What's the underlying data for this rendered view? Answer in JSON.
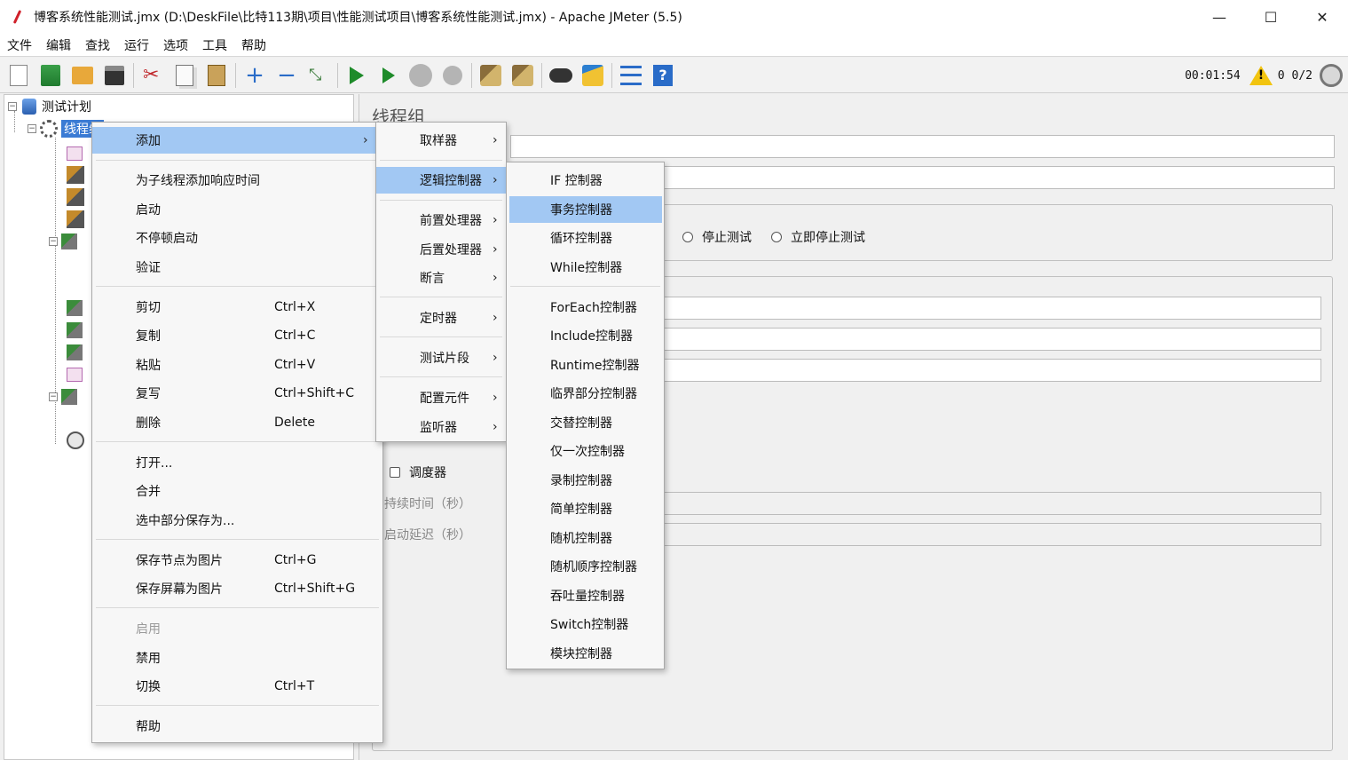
{
  "window": {
    "title": "博客系统性能测试.jmx (D:\\DeskFile\\比特113期\\项目\\性能测试项目\\博客系统性能测试.jmx) - Apache JMeter (5.5)",
    "minimize": "—",
    "maximize": "☐",
    "close": "✕"
  },
  "menubar": [
    "文件",
    "编辑",
    "查找",
    "运行",
    "选项",
    "工具",
    "帮助"
  ],
  "toolbar": {
    "icons": [
      "new-icon",
      "templates-icon",
      "open-icon",
      "save-icon",
      "cut-icon",
      "copy-icon",
      "paste-icon",
      "expand-icon",
      "collapse-icon",
      "toggle-icon",
      "start-icon",
      "start-no-pause-icon",
      "stop-icon",
      "shutdown-icon",
      "clear-icon",
      "clear-all-icon",
      "search-icon",
      "reset-search-icon",
      "function-helper-icon",
      "help-icon"
    ],
    "elapsed": "00:01:54",
    "error_count": "0",
    "threads": "0/2"
  },
  "tree": {
    "root": "测试计划",
    "selected": "线程组"
  },
  "panel": {
    "title": "线程组",
    "on_error_options": [
      "停止测试",
      "立即停止测试"
    ],
    "scheduler_label": "调度器",
    "duration_label": "持续时间（秒）",
    "startup_delay_label": "启动延迟（秒）"
  },
  "context_menu": {
    "add": "添加",
    "add_think_time": "为子线程添加响应时间",
    "start": "启动",
    "start_no_pause": "不停顿启动",
    "validate": "验证",
    "cut": "剪切",
    "cut_key": "Ctrl+X",
    "copy": "复制",
    "copy_key": "Ctrl+C",
    "paste": "粘贴",
    "paste_key": "Ctrl+V",
    "duplicate": "复写",
    "duplicate_key": "Ctrl+Shift+C",
    "remove": "删除",
    "remove_key": "Delete",
    "open": "打开...",
    "merge": "合并",
    "save_selection": "选中部分保存为...",
    "save_node_image": "保存节点为图片",
    "save_node_image_key": "Ctrl+G",
    "save_screen_image": "保存屏幕为图片",
    "save_screen_image_key": "Ctrl+Shift+G",
    "enable": "启用",
    "disable": "禁用",
    "toggle": "切换",
    "toggle_key": "Ctrl+T",
    "help": "帮助"
  },
  "add_menu": {
    "sampler": "取样器",
    "logic_controller": "逻辑控制器",
    "pre_processor": "前置处理器",
    "post_processor": "后置处理器",
    "assertion": "断言",
    "timer": "定时器",
    "test_fragment": "测试片段",
    "config_element": "配置元件",
    "listener": "监听器"
  },
  "logic_menu": [
    "IF 控制器",
    "事务控制器",
    "循环控制器",
    "While控制器",
    "ForEach控制器",
    "Include控制器",
    "Runtime控制器",
    "临界部分控制器",
    "交替控制器",
    "仅一次控制器",
    "录制控制器",
    "简单控制器",
    "随机控制器",
    "随机顺序控制器",
    "吞吐量控制器",
    "Switch控制器",
    "模块控制器"
  ],
  "colors": {
    "highlight": "#a2c8f3",
    "selection": "#3b7bd4",
    "start_green": "#1e8b2a"
  }
}
